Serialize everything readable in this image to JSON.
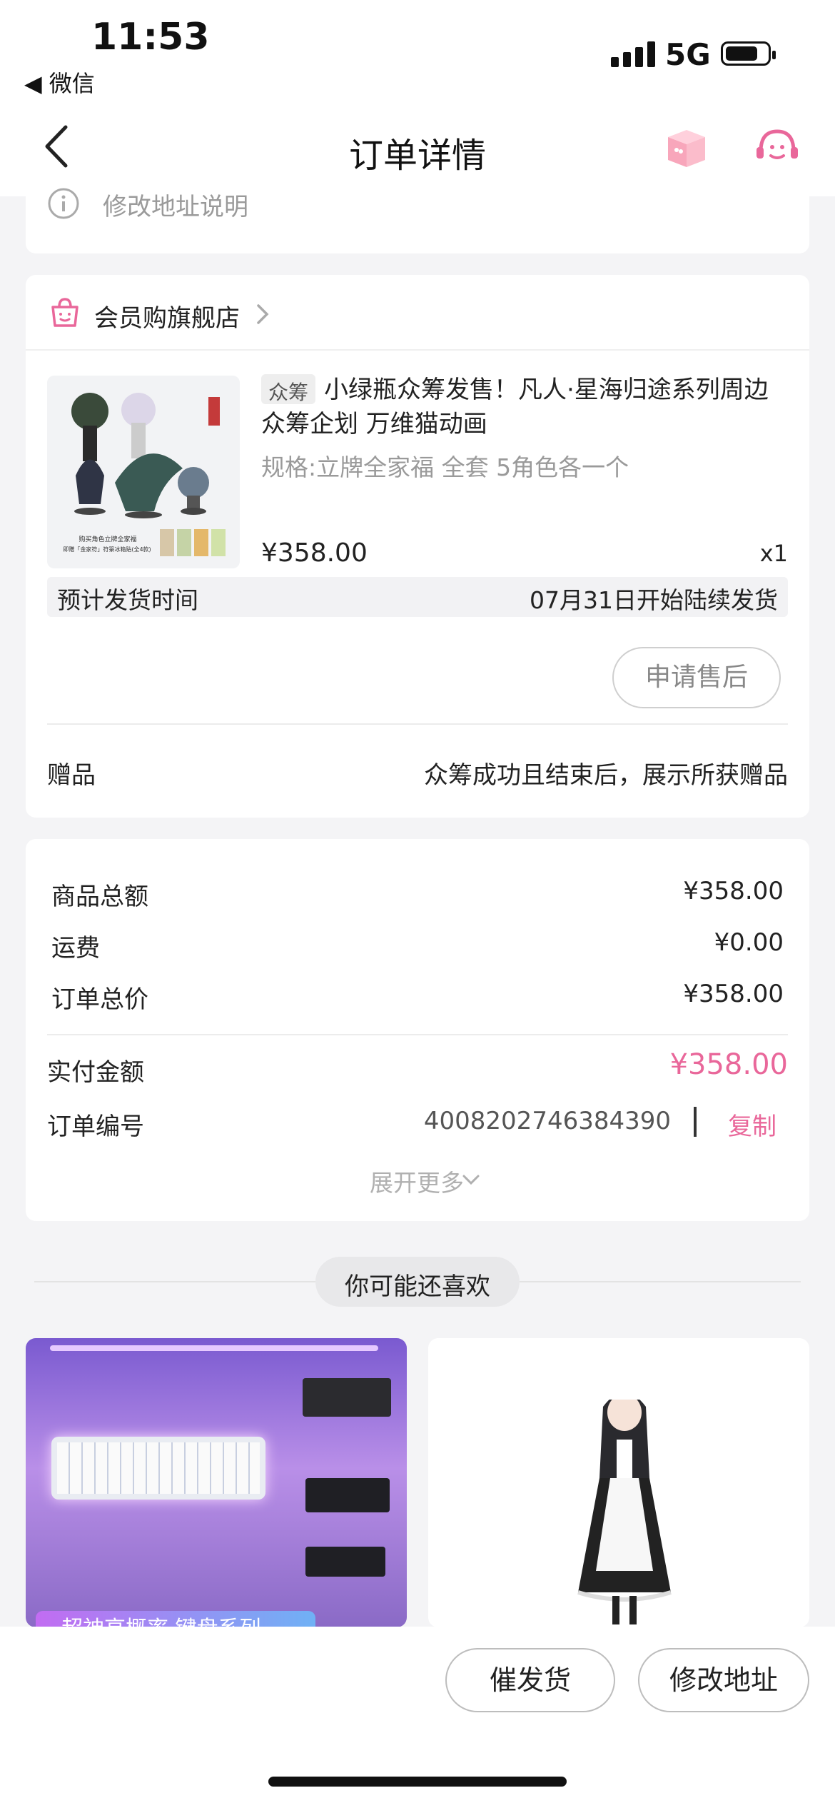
{
  "status_bar": {
    "time": "11:53",
    "back_app": "◀ 微信",
    "network": "5G"
  },
  "nav": {
    "title": "订单详情"
  },
  "address": {
    "note": "修改地址说明"
  },
  "store": {
    "name": "会员购旗舰店"
  },
  "product": {
    "tag": "众筹",
    "title": "小绿瓶众筹发售！凡人·星海归途系列周边 众筹企划 万维猫动画",
    "spec": "规格:立牌全家福 全套 5角色各一个",
    "price": "¥358.00",
    "qty": "x1",
    "ship_label": "预计发货时间",
    "ship_value": "07月31日开始陆续发货",
    "aftersale": "申请售后",
    "gift_label": "赠品",
    "gift_value": "众筹成功且结束后，展示所获赠品",
    "image_caption_1": "购买角色立牌全家福",
    "image_caption_2": "即赠「金家符」符箓冰箱贴(全4款)"
  },
  "summary": {
    "rows": [
      {
        "label": "商品总额",
        "value": "¥358.00"
      },
      {
        "label": "运费",
        "value": "¥0.00"
      },
      {
        "label": "订单总价",
        "value": "¥358.00"
      }
    ],
    "paid_label": "实付金额",
    "paid_value": "¥358.00",
    "order_label": "订单编号",
    "order_no": "4008202746384390",
    "copy": "复制",
    "expand": "展开更多"
  },
  "recommend": {
    "title": "你可能还喜欢",
    "item1_banner": "超神高概率 键盘系列"
  },
  "bottom_bar": {
    "btn1": "催发货",
    "btn2": "修改地址"
  },
  "colors": {
    "accent": "#e9679a",
    "background": "#f4f4f6"
  }
}
